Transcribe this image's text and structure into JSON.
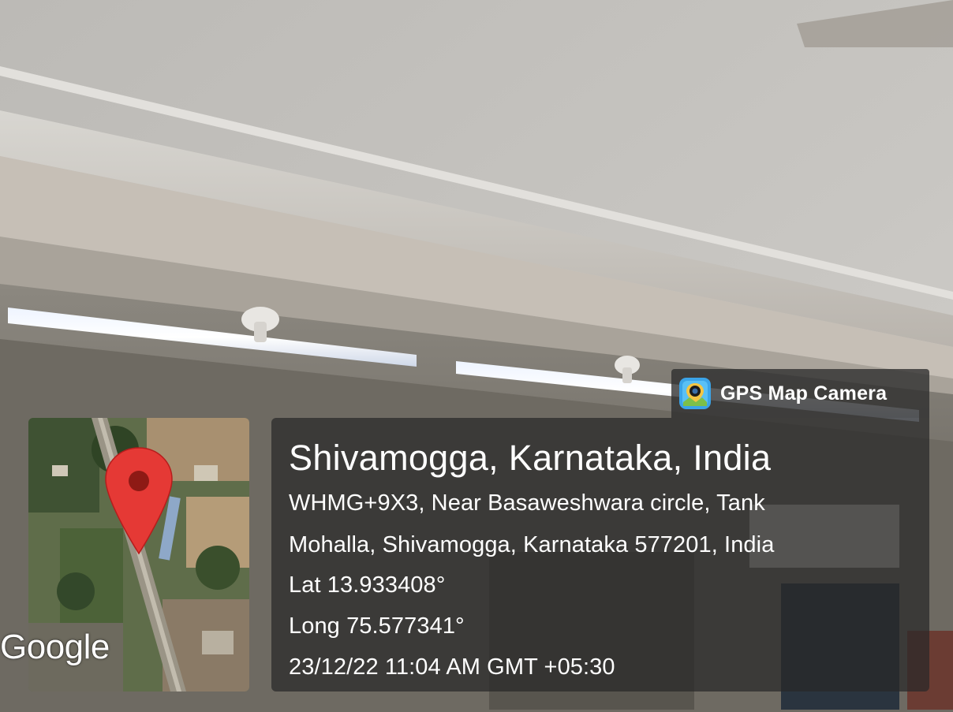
{
  "badge": {
    "label": "GPS Map Camera",
    "icon": "gps-map-camera-app-icon"
  },
  "map": {
    "attribution": "Google",
    "pin_icon": "map-pin-icon",
    "pin_color": "#e53935"
  },
  "location": {
    "title": "Shivamogga, Karnataka, India",
    "address_line_1": "WHMG+9X3, Near Basaweshwara circle, Tank",
    "address_line_2": "Mohalla, Shivamogga, Karnataka 577201, India",
    "latitude": "Lat 13.933408°",
    "longitude": "Long 75.577341°",
    "datetime": "23/12/22 11:04 AM GMT +05:30"
  }
}
